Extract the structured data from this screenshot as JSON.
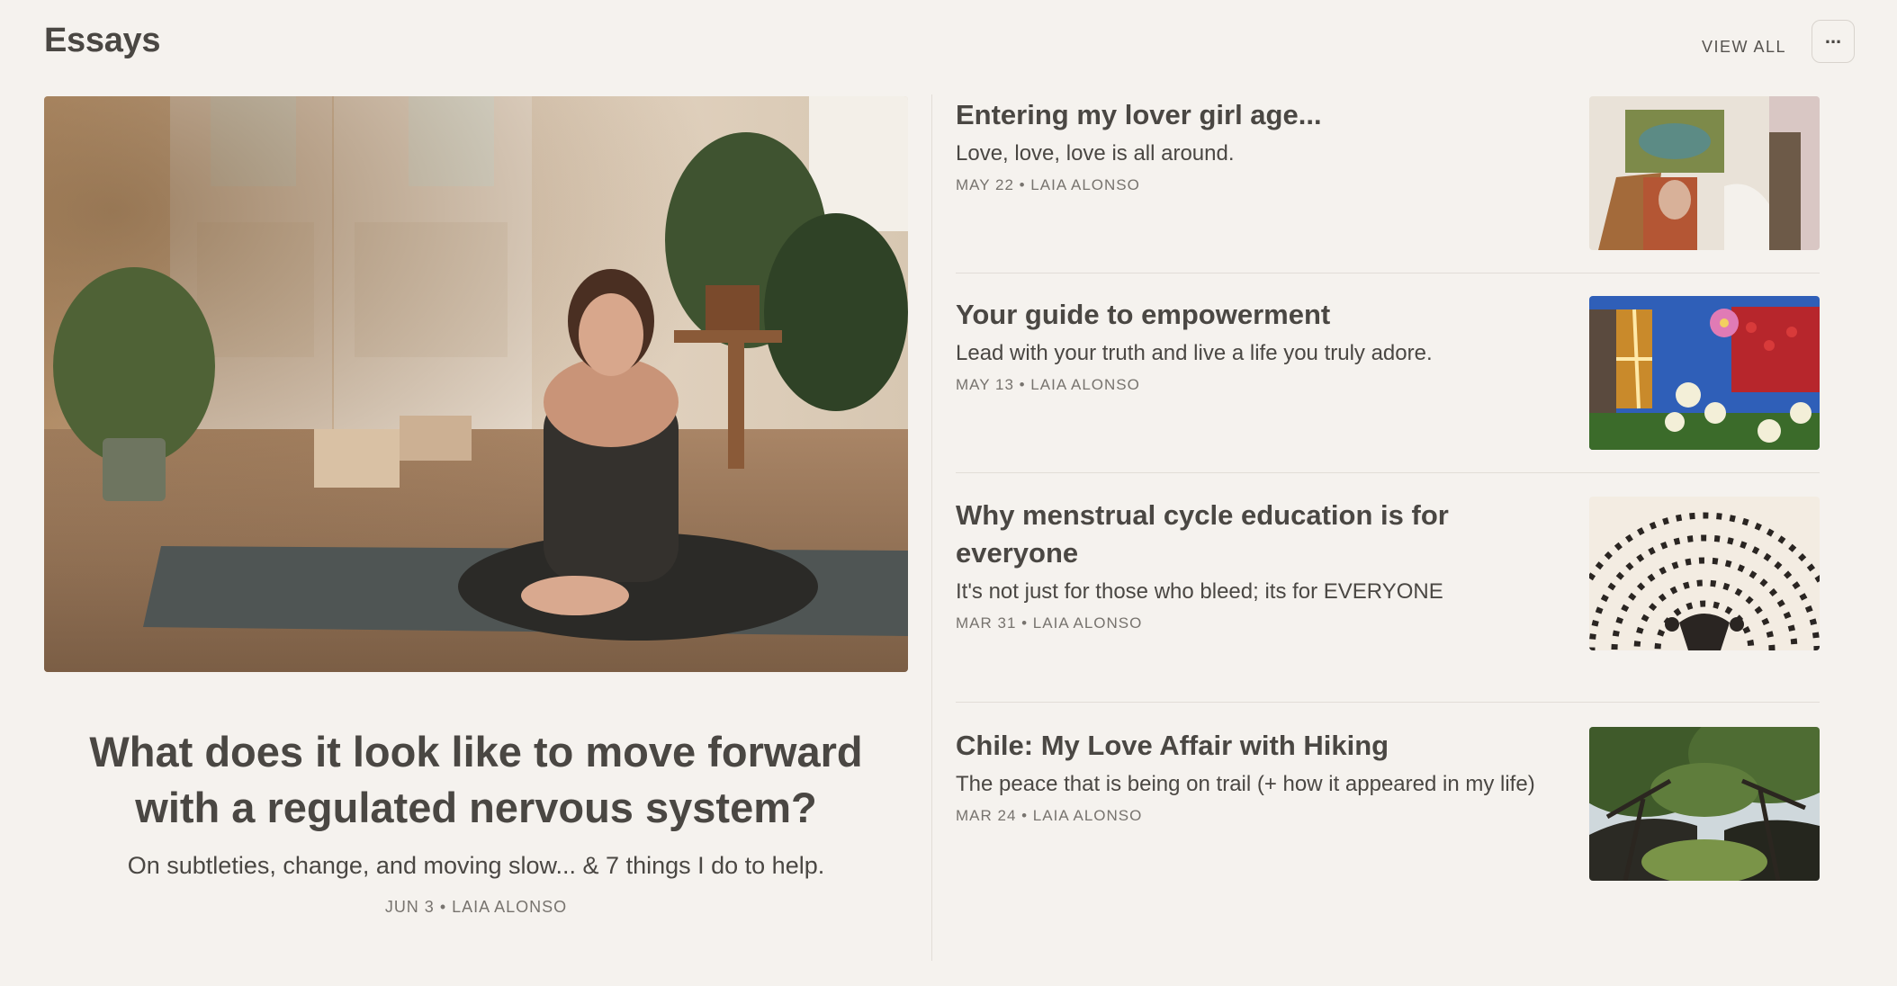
{
  "header": {
    "title": "Essays",
    "view_all": "VIEW ALL",
    "more_label": "..."
  },
  "featured": {
    "title": "What does it look like to move forward with a regulated nervous system?",
    "subtitle": "On subtleties, change, and moving slow... & 7 things I do to help.",
    "meta": "JUN 3 • LAIA ALONSO"
  },
  "posts": [
    {
      "title": "Entering my lover girl age...",
      "subtitle": "Love, love, love is all around.",
      "meta": "MAY 22 • LAIA ALONSO"
    },
    {
      "title": "Your guide to empowerment",
      "subtitle": "Lead with your truth and live a life you truly adore.",
      "meta": "MAY 13 • LAIA ALONSO"
    },
    {
      "title": "Why menstrual cycle education is for everyone",
      "subtitle": "It's not just for those who bleed; its for EVERYONE",
      "meta": "MAR 31 • LAIA ALONSO"
    },
    {
      "title": "Chile: My Love Affair with Hiking",
      "subtitle": "The peace that is being on trail (+ how it appeared in my life)",
      "meta": "MAR 24 • LAIA ALONSO"
    }
  ]
}
